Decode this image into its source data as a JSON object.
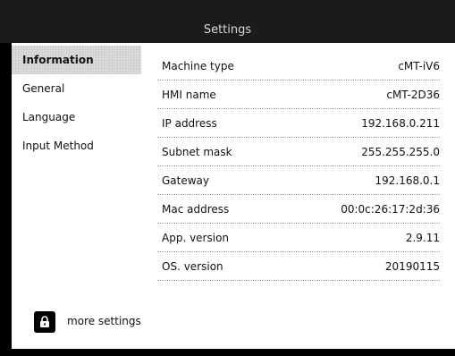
{
  "title": "Settings",
  "sidebar": {
    "items": [
      {
        "label": "Information",
        "active": true
      },
      {
        "label": "General",
        "active": false
      },
      {
        "label": "Language",
        "active": false
      },
      {
        "label": "Input Method",
        "active": false
      }
    ]
  },
  "info": {
    "rows": [
      {
        "label": "Machine type",
        "value": "cMT-iV6"
      },
      {
        "label": "HMI name",
        "value": "cMT-2D36"
      },
      {
        "label": "IP address",
        "value": "192.168.0.211"
      },
      {
        "label": "Subnet mask",
        "value": "255.255.255.0"
      },
      {
        "label": "Gateway",
        "value": "192.168.0.1"
      },
      {
        "label": "Mac address",
        "value": "00:0c:26:17:2d:36"
      },
      {
        "label": "App. version",
        "value": "2.9.11"
      },
      {
        "label": "OS. version",
        "value": "20190115"
      }
    ]
  },
  "more_settings": {
    "icon": "lock-icon",
    "label": "more settings"
  },
  "colors": {
    "frame": "#000000",
    "titlebar": "#1b1b1b",
    "active_item": "#d9d9d9"
  }
}
